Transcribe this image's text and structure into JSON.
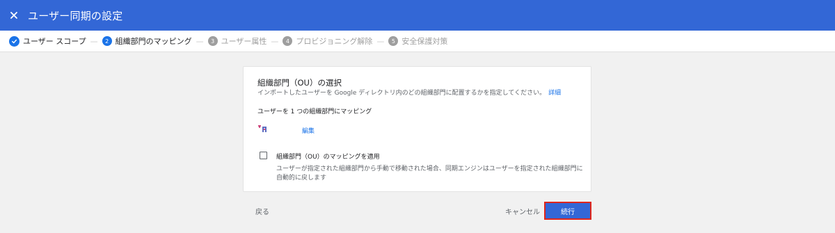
{
  "header": {
    "title": "ユーザー同期の設定",
    "close_icon": "close-icon",
    "background": "#3367d6"
  },
  "stepper": {
    "steps": [
      {
        "number": "",
        "label": "ユーザー スコープ",
        "state": "done"
      },
      {
        "number": "2",
        "label": "組織部門のマッピング",
        "state": "active"
      },
      {
        "number": "3",
        "label": "ユーザー属性",
        "state": "todo"
      },
      {
        "number": "4",
        "label": "プロビジョニング解除",
        "state": "todo"
      },
      {
        "number": "5",
        "label": "安全保護対策",
        "state": "todo"
      }
    ],
    "separator": "—"
  },
  "card": {
    "title": "組織部門（OU）の選択",
    "description": "インポートしたユーザーを Google ディレクトリ内のどの組織部門に配置するかを指定してください。",
    "details_link": "詳細",
    "mapping_text": "ユーザーを 1 つの組織部門にマッピング",
    "edit_link": "編集",
    "checkbox": {
      "checked": false,
      "label": "組織部門（OU）のマッピングを適用",
      "description": "ユーザーが指定された組織部門から手動で移動された場合、同期エンジンはユーザーを指定された組織部門に自動的に戻します"
    }
  },
  "footer": {
    "back_label": "戻る",
    "cancel_label": "キャンセル",
    "continue_label": "続行"
  },
  "colors": {
    "accent": "#1a73e8",
    "primary_button": "#3367d6",
    "highlight_border": "#e0261b"
  }
}
